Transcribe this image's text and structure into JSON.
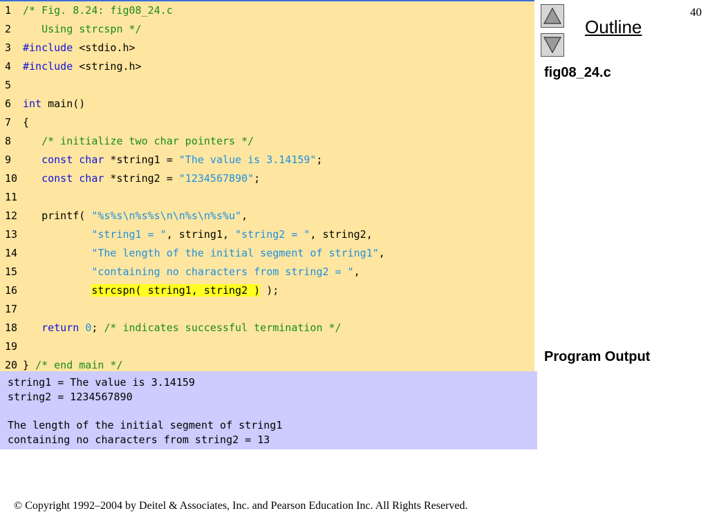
{
  "page_number": "40",
  "outline": {
    "title": "Outline"
  },
  "labels": {
    "file": "fig08_24.c",
    "program_output": "Program Output"
  },
  "code": {
    "lines": [
      {
        "n": "1",
        "segs": [
          {
            "t": "/* Fig. 8.24: fig08_24.c",
            "c": "comment"
          }
        ]
      },
      {
        "n": "2",
        "segs": [
          {
            "t": "   Using strcspn */",
            "c": "comment"
          }
        ]
      },
      {
        "n": "3",
        "segs": [
          {
            "t": "#include",
            "c": "kw"
          },
          {
            "t": " <stdio.h>",
            "c": "plain"
          }
        ]
      },
      {
        "n": "4",
        "segs": [
          {
            "t": "#include",
            "c": "kw"
          },
          {
            "t": " <string.h>",
            "c": "plain"
          }
        ]
      },
      {
        "n": "5",
        "segs": []
      },
      {
        "n": "6",
        "segs": [
          {
            "t": "int",
            "c": "kw"
          },
          {
            "t": " main()",
            "c": "plain"
          }
        ]
      },
      {
        "n": "7",
        "segs": [
          {
            "t": "{",
            "c": "plain"
          }
        ]
      },
      {
        "n": "8",
        "segs": [
          {
            "t": "   /* initialize two char pointers */",
            "c": "comment"
          }
        ]
      },
      {
        "n": "9",
        "segs": [
          {
            "t": "   ",
            "c": "plain"
          },
          {
            "t": "const",
            "c": "kw"
          },
          {
            "t": " ",
            "c": "plain"
          },
          {
            "t": "char",
            "c": "kw"
          },
          {
            "t": " *string1 = ",
            "c": "plain"
          },
          {
            "t": "\"The value is 3.14159\"",
            "c": "str"
          },
          {
            "t": ";",
            "c": "plain"
          }
        ]
      },
      {
        "n": "10",
        "segs": [
          {
            "t": "   ",
            "c": "plain"
          },
          {
            "t": "const",
            "c": "kw"
          },
          {
            "t": " ",
            "c": "plain"
          },
          {
            "t": "char",
            "c": "kw"
          },
          {
            "t": " *string2 = ",
            "c": "plain"
          },
          {
            "t": "\"1234567890\"",
            "c": "str"
          },
          {
            "t": ";",
            "c": "plain"
          }
        ]
      },
      {
        "n": "11",
        "segs": []
      },
      {
        "n": "12",
        "segs": [
          {
            "t": "   printf( ",
            "c": "plain"
          },
          {
            "t": "\"%s%s\\n%s%s\\n\\n%s\\n%s%u\"",
            "c": "str"
          },
          {
            "t": ",",
            "c": "plain"
          }
        ]
      },
      {
        "n": "13",
        "segs": [
          {
            "t": "           ",
            "c": "plain"
          },
          {
            "t": "\"string1 = \"",
            "c": "str"
          },
          {
            "t": ", string1, ",
            "c": "plain"
          },
          {
            "t": "\"string2 = \"",
            "c": "str"
          },
          {
            "t": ", string2,",
            "c": "plain"
          }
        ]
      },
      {
        "n": "14",
        "segs": [
          {
            "t": "           ",
            "c": "plain"
          },
          {
            "t": "\"The length of the initial segment of string1\"",
            "c": "str"
          },
          {
            "t": ",",
            "c": "plain"
          }
        ]
      },
      {
        "n": "15",
        "segs": [
          {
            "t": "           ",
            "c": "plain"
          },
          {
            "t": "\"containing no characters from string2 = \"",
            "c": "str"
          },
          {
            "t": ",",
            "c": "plain"
          }
        ]
      },
      {
        "n": "16",
        "segs": [
          {
            "t": "           ",
            "c": "plain"
          },
          {
            "t": "strcspn( string1, string2 )",
            "c": "hl"
          },
          {
            "t": " );",
            "c": "plain"
          }
        ]
      },
      {
        "n": "17",
        "segs": []
      },
      {
        "n": "18",
        "segs": [
          {
            "t": "   ",
            "c": "plain"
          },
          {
            "t": "return",
            "c": "kw"
          },
          {
            "t": " ",
            "c": "plain"
          },
          {
            "t": "0",
            "c": "num"
          },
          {
            "t": "; ",
            "c": "plain"
          },
          {
            "t": "/* indicates successful termination */",
            "c": "comment"
          }
        ]
      },
      {
        "n": "19",
        "segs": []
      },
      {
        "n": "20",
        "segs": [
          {
            "t": "} ",
            "c": "plain"
          },
          {
            "t": "/* end main */",
            "c": "comment"
          }
        ]
      }
    ]
  },
  "output": {
    "lines": [
      "string1 = The value is 3.14159",
      "string2 = 1234567890",
      "",
      "The length of the initial segment of string1",
      "containing no characters from string2 = 13"
    ]
  },
  "copyright": "© Copyright 1992–2004 by Deitel & Associates, Inc. and Pearson Education Inc. All Rights Reserved."
}
